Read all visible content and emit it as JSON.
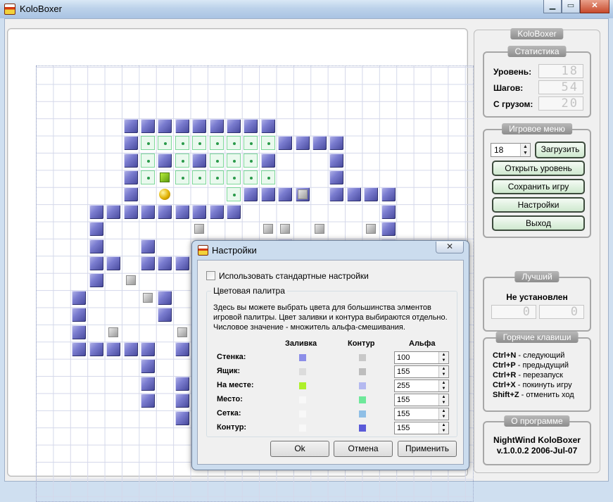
{
  "window": {
    "title": "KoloBoxer",
    "minimize": "▁",
    "maximize": "▭",
    "close": "✕"
  },
  "board": {
    "walls": [
      [
        5,
        3
      ],
      [
        6,
        3
      ],
      [
        7,
        3
      ],
      [
        8,
        3
      ],
      [
        9,
        3
      ],
      [
        10,
        3
      ],
      [
        11,
        3
      ],
      [
        12,
        3
      ],
      [
        13,
        3
      ],
      [
        5,
        4
      ],
      [
        14,
        4
      ],
      [
        15,
        4
      ],
      [
        16,
        4
      ],
      [
        17,
        4
      ],
      [
        5,
        5
      ],
      [
        7,
        5
      ],
      [
        9,
        5
      ],
      [
        13,
        5
      ],
      [
        17,
        5
      ],
      [
        5,
        6
      ],
      [
        17,
        6
      ],
      [
        5,
        7
      ],
      [
        12,
        7
      ],
      [
        13,
        7
      ],
      [
        14,
        7
      ],
      [
        15,
        7
      ],
      [
        17,
        7
      ],
      [
        18,
        7
      ],
      [
        19,
        7
      ],
      [
        20,
        7
      ],
      [
        3,
        8
      ],
      [
        4,
        8
      ],
      [
        5,
        8
      ],
      [
        6,
        8
      ],
      [
        7,
        8
      ],
      [
        8,
        8
      ],
      [
        9,
        8
      ],
      [
        10,
        8
      ],
      [
        11,
        8
      ],
      [
        20,
        8
      ],
      [
        3,
        9
      ],
      [
        20,
        9
      ],
      [
        3,
        10
      ],
      [
        6,
        10
      ],
      [
        14,
        10
      ],
      [
        20,
        10
      ],
      [
        3,
        11
      ],
      [
        4,
        11
      ],
      [
        6,
        11
      ],
      [
        7,
        11
      ],
      [
        8,
        11
      ],
      [
        9,
        11
      ],
      [
        10,
        11
      ],
      [
        14,
        11
      ],
      [
        20,
        11
      ],
      [
        3,
        12
      ],
      [
        2,
        13
      ],
      [
        7,
        13
      ],
      [
        2,
        14
      ],
      [
        7,
        14
      ],
      [
        2,
        15
      ],
      [
        2,
        16
      ],
      [
        3,
        16
      ],
      [
        4,
        16
      ],
      [
        5,
        16
      ],
      [
        6,
        16
      ],
      [
        8,
        16
      ],
      [
        6,
        17
      ],
      [
        6,
        18
      ],
      [
        8,
        18
      ],
      [
        6,
        19
      ],
      [
        8,
        19
      ],
      [
        8,
        20
      ],
      [
        9,
        21
      ]
    ],
    "goals": [
      [
        6,
        4
      ],
      [
        7,
        4
      ],
      [
        8,
        4
      ],
      [
        9,
        4
      ],
      [
        10,
        4
      ],
      [
        11,
        4
      ],
      [
        12,
        4
      ],
      [
        13,
        4
      ],
      [
        6,
        5
      ],
      [
        8,
        5
      ],
      [
        10,
        5
      ],
      [
        11,
        5
      ],
      [
        12,
        5
      ],
      [
        6,
        6
      ],
      [
        8,
        6
      ],
      [
        9,
        6
      ],
      [
        10,
        6
      ],
      [
        11,
        6
      ],
      [
        12,
        6
      ],
      [
        13,
        6
      ],
      [
        11,
        7
      ]
    ],
    "boxes": [
      [
        15,
        7
      ],
      [
        14,
        9
      ],
      [
        9,
        9
      ],
      [
        13,
        9
      ],
      [
        16,
        9
      ],
      [
        19,
        9
      ],
      [
        14,
        10
      ],
      [
        16,
        10
      ],
      [
        19,
        10
      ],
      [
        5,
        12
      ],
      [
        6,
        13
      ],
      [
        9,
        14
      ],
      [
        4,
        15
      ],
      [
        8,
        15
      ],
      [
        9,
        15
      ]
    ],
    "boxes_on_goal": [
      [
        7,
        6
      ]
    ],
    "player": [
      7,
      7
    ]
  },
  "sidebar": {
    "title": "KoloBoxer",
    "stats": {
      "title": "Статистика",
      "level_label": "Уровень:",
      "level_value": "18",
      "steps_label": "Шагов:",
      "steps_value": "54",
      "pushes_label": "С грузом:",
      "pushes_value": "20"
    },
    "menu": {
      "title": "Игровое меню",
      "level_input": "18",
      "load": "Загрузить",
      "open": "Открыть уровень",
      "save": "Сохранить игру",
      "settings": "Настройки",
      "exit": "Выход"
    },
    "best": {
      "title": "Лучший",
      "status": "Не установлен",
      "steps": "0",
      "pushes": "0"
    },
    "hotkeys": {
      "title": "Горячие клавиши",
      "items": [
        {
          "key": "Ctrl+N",
          "text": " - следующий"
        },
        {
          "key": "Ctrl+P",
          "text": " - предыдущий"
        },
        {
          "key": "Ctrl+R",
          "text": " - перезапуск"
        },
        {
          "key": "Ctrl+X",
          "text": " - покинуть игру"
        },
        {
          "key": "Shift+Z",
          "text": " - отменить ход"
        }
      ]
    },
    "about": {
      "title": "О программе",
      "line1": "NightWind KoloBoxer",
      "line2": "v.1.0.0.2 2006-Jul-07"
    }
  },
  "dialog": {
    "title": "Настройки",
    "close": "✕",
    "use_default": "Использовать стандартные настройки",
    "palette_title": "Цветовая палитра",
    "description": "Здесь вы можете выбрать цвета для большинства элментов игровой палитры. Цвет заливки и контура выбираются отдельно. Числовое значение - множитель альфа-смешивания.",
    "col_fill": "Заливка",
    "col_outline": "Контур",
    "col_alpha": "Альфа",
    "rows": [
      {
        "label": "Стенка:",
        "fill": "#8c8ee8",
        "outline": "#c8c8c8",
        "alpha": "100"
      },
      {
        "label": "Ящик:",
        "fill": "#dcdcdc",
        "outline": "#bdbdbd",
        "alpha": "155"
      },
      {
        "label": "На месте:",
        "fill": "#aef02a",
        "outline": "#b4b9f0",
        "alpha": "255"
      },
      {
        "label": "Место:",
        "fill": "#f8f8f8",
        "outline": "#6ee89a",
        "alpha": "155"
      },
      {
        "label": "Сетка:",
        "fill": "#f8f8f8",
        "outline": "#8fbfe6",
        "alpha": "155"
      },
      {
        "label": "Контур:",
        "fill": "#f8f8f8",
        "outline": "#5a5ad8",
        "alpha": "155"
      }
    ],
    "ok": "Ok",
    "cancel": "Отмена",
    "apply": "Применить"
  }
}
